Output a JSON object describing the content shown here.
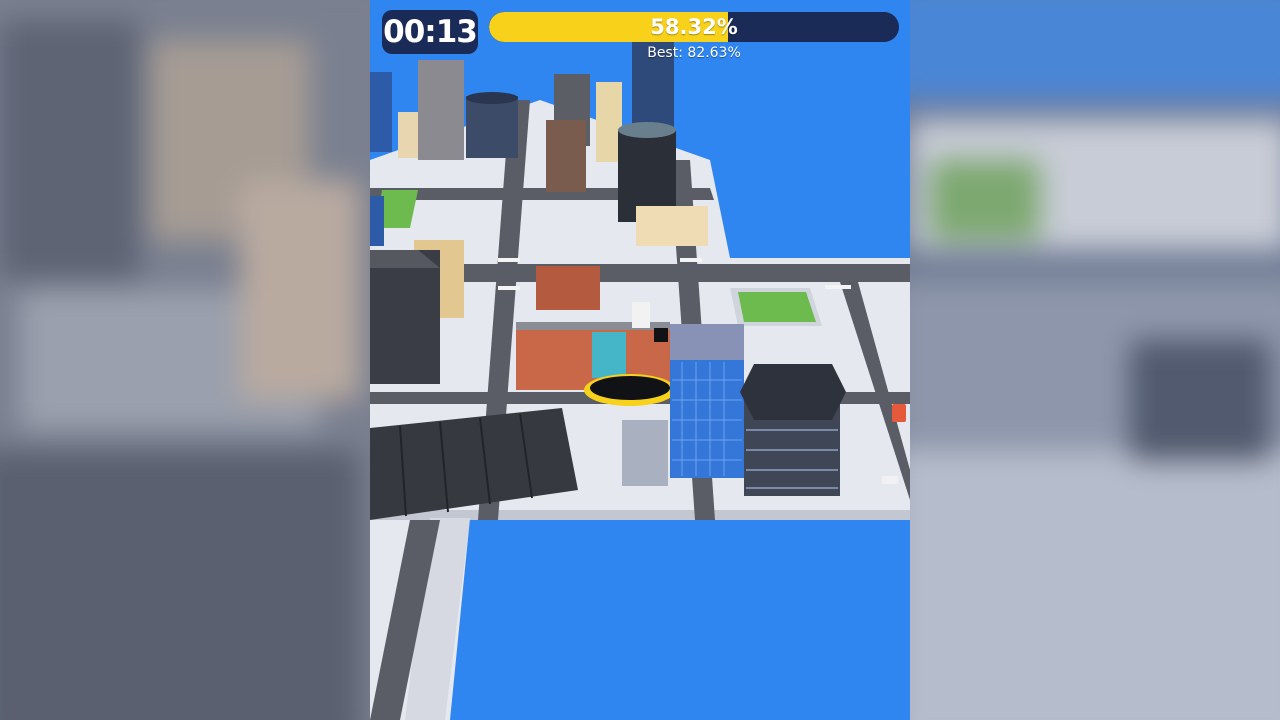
{
  "hud": {
    "timer": "00:13",
    "progress": {
      "label": "58.32%",
      "value_pct": 58.32
    },
    "best": "Best: 82.63%"
  },
  "colors": {
    "water": "#2f86f0",
    "hud_dark": "#1a2b57",
    "progress_fill": "#f7d11a",
    "ground": "#e6e8ef",
    "road": "#5a5d66",
    "grass": "#6dbb4e"
  },
  "scene": {
    "player": "black-hole-player"
  }
}
